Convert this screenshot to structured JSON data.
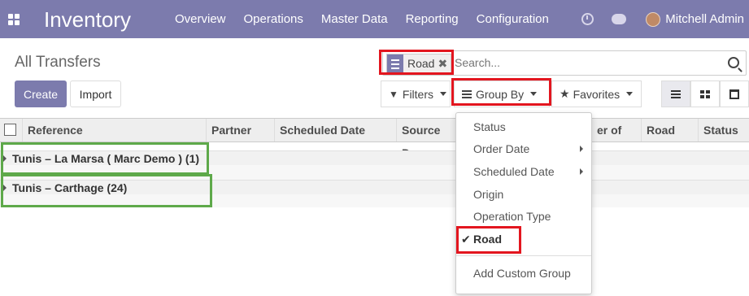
{
  "app": {
    "title": "Inventory"
  },
  "nav": {
    "menu": [
      "Overview",
      "Operations",
      "Master Data",
      "Reporting",
      "Configuration"
    ],
    "user": "Mitchell Admin"
  },
  "control": {
    "breadcrumb": "All Transfers",
    "create_label": "Create",
    "import_label": "Import",
    "filters_label": "Filters",
    "group_by_label": "Group By",
    "favorites_label": "Favorites"
  },
  "search": {
    "facet_value": "Road",
    "placeholder": "Search..."
  },
  "table": {
    "columns": [
      "Reference",
      "Partner",
      "Scheduled Date",
      "Source Do",
      "er of",
      "Road",
      "Status"
    ],
    "groups": [
      {
        "label": "Tunis – La Marsa ( Marc Demo ) (1)"
      },
      {
        "label": "Tunis – Carthage (24)"
      }
    ]
  },
  "group_by_menu": {
    "items": [
      "Status",
      "Order Date",
      "Scheduled Date",
      "Origin",
      "Operation Type",
      "Road"
    ],
    "selected": "Road",
    "custom_label": "Add Custom Group"
  },
  "colors": {
    "navbar": "#7c7bad",
    "highlight_red": "#e3161f",
    "highlight_green": "#5ea94a"
  }
}
